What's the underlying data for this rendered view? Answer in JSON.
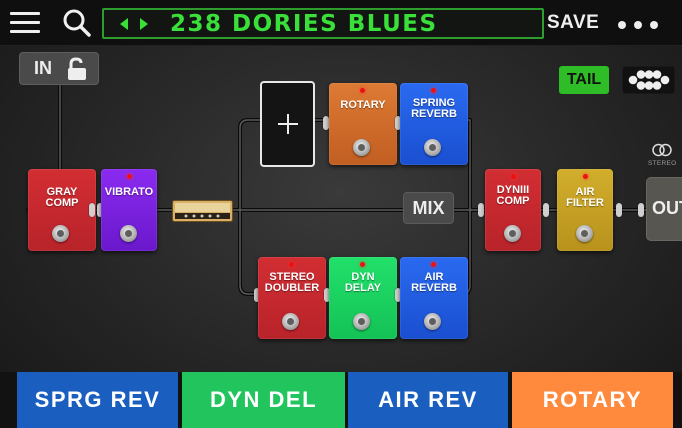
{
  "colors": {
    "accent_green": "#39e039",
    "pedal_red": "#c9252b",
    "pedal_purple": "#7a1ee0",
    "pedal_orange": "#d06a2a",
    "pedal_blue": "#1f5ee0",
    "pedal_green": "#1bd45a",
    "pedal_yellow": "#c8a422",
    "fs_blue": "#1a5fc0",
    "fs_green": "#22c45e",
    "fs_orange": "#ff8a3d"
  },
  "topbar": {
    "menu_icon": "hamburger-icon",
    "search_icon": "search-icon",
    "preset_name": "238 DORIES BLUES",
    "save_label": "SAVE",
    "more_icon": "more-dots-icon"
  },
  "signal": {
    "input_label": "IN",
    "input_lock_icon": "unlock-icon",
    "mix_label": "MIX",
    "tail_label": "TAIL",
    "grid_icon": "grid-icon",
    "stereo_label": "STEREO",
    "output_label": "OUT",
    "amp_icon": "amp-icon",
    "add_icon": "plus-icon"
  },
  "pedals": {
    "gray_comp": "GRAY\nCOMP",
    "vibrato": "VIBRATO",
    "rotary": "ROTARY",
    "spring_reverb": "SPRING\nREVERB",
    "stereo_doubler": "STEREO\nDOUBLER",
    "dyn_delay": "DYN\nDELAY",
    "air_reverb": "AIR\nREVERB",
    "dyniii_comp": "DYNIII\nCOMP",
    "air_filter": "AIR\nFILTER"
  },
  "footswitches": [
    {
      "label": "SPRG REV",
      "color": "#1a5fc0"
    },
    {
      "label": "DYN DEL",
      "color": "#22c45e"
    },
    {
      "label": "AIR REV",
      "color": "#1a5fc0"
    },
    {
      "label": "ROTARY",
      "color": "#ff8a3d"
    }
  ]
}
